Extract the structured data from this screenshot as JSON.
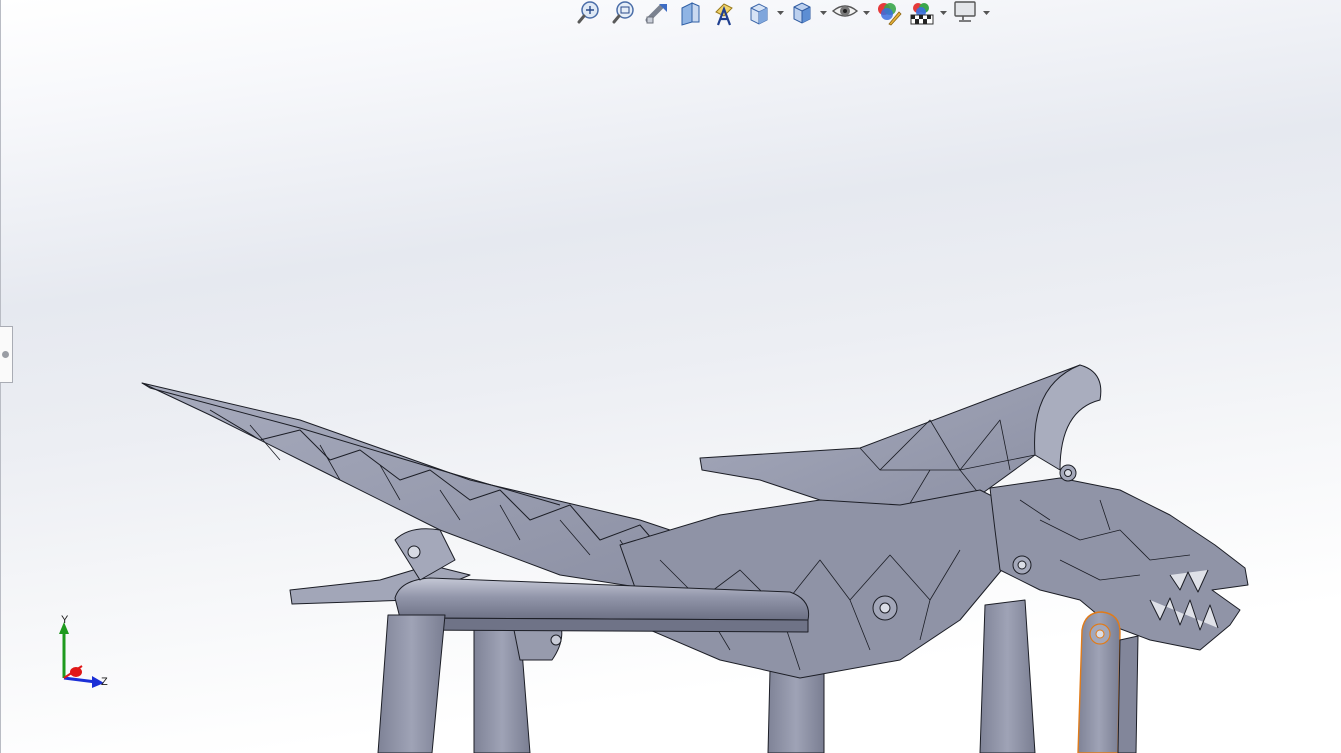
{
  "window": {
    "title": ""
  },
  "toolbar": {
    "items": [
      {
        "name": "zoom-to-fit",
        "icon": "zoom-to-fit-icon"
      },
      {
        "name": "zoom-to-area",
        "icon": "zoom-to-area-icon"
      },
      {
        "name": "previous-view",
        "icon": "previous-view-icon"
      },
      {
        "name": "section-view",
        "icon": "section-view-icon"
      },
      {
        "name": "dynamic-annotation-views",
        "icon": "annotation-view-icon"
      },
      {
        "name": "view-orientation",
        "icon": "view-orientation-icon",
        "dropdown": true
      },
      {
        "name": "display-style",
        "icon": "display-style-icon",
        "dropdown": true
      },
      {
        "name": "hide-show-items",
        "icon": "eye-icon",
        "dropdown": true
      },
      {
        "name": "edit-appearance",
        "icon": "edit-appearance-icon"
      },
      {
        "name": "apply-scene",
        "icon": "apply-scene-icon",
        "dropdown": true
      },
      {
        "name": "view-settings",
        "icon": "monitor-icon",
        "dropdown": true
      }
    ]
  },
  "triad": {
    "y_label": "Y",
    "z_label": "Z",
    "x_color": "#e01818",
    "y_color": "#1e9a1e",
    "z_color": "#1b2fd6"
  },
  "model": {
    "description_icon": "dragon-assembly-model",
    "surface_color": "#8f93a6",
    "edge_color": "#1c1e26",
    "selection_color": "#e07b1a"
  }
}
